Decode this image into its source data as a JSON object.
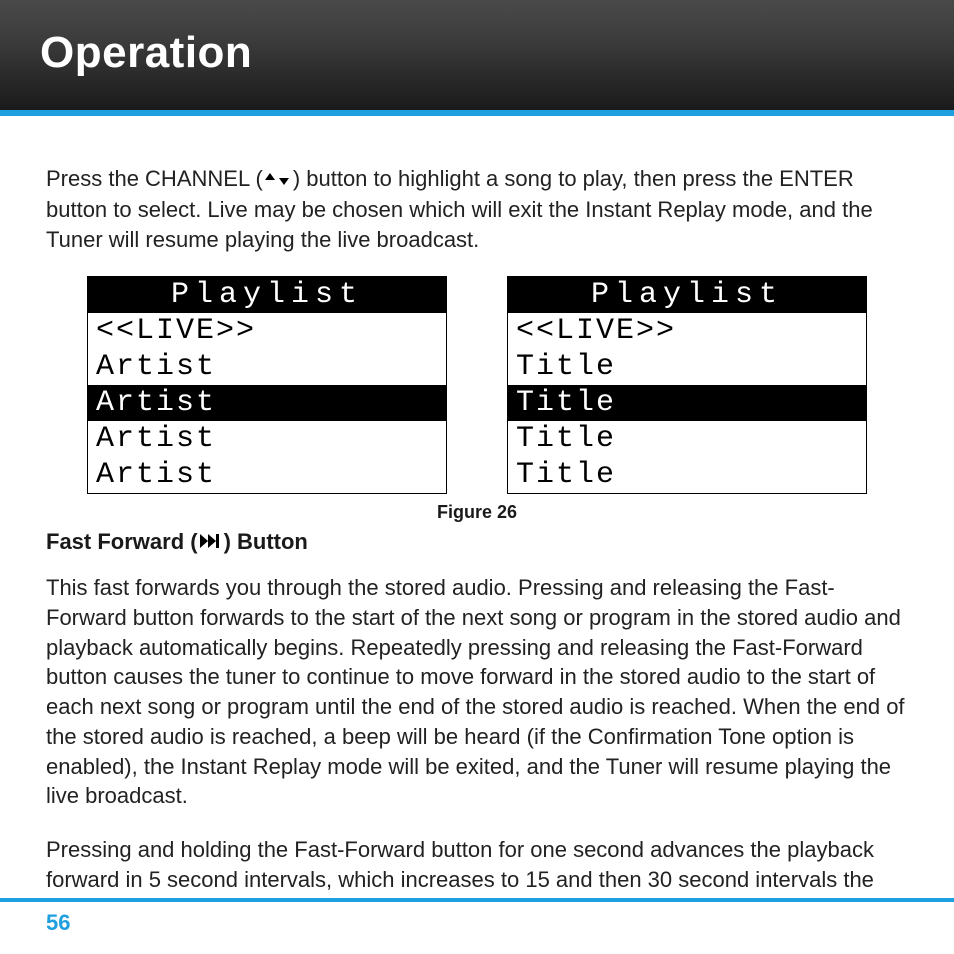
{
  "header": {
    "title": "Operation"
  },
  "intro": {
    "part1": "Press the CHANNEL (",
    "part2": ") button to highlight a song to play, then press the ENTER button to select. Live may be chosen which will exit the Instant Replay mode, and the Tuner will resume playing the live broadcast."
  },
  "figure": {
    "caption": "Figure 26",
    "left": {
      "header": "Playlist",
      "rows": [
        {
          "text": "<<LIVE>>",
          "highlight": false
        },
        {
          "text": "Artist",
          "highlight": false
        },
        {
          "text": "Artist",
          "highlight": true
        },
        {
          "text": "Artist",
          "highlight": false
        },
        {
          "text": "Artist",
          "highlight": false
        }
      ]
    },
    "right": {
      "header": "Playlist",
      "rows": [
        {
          "text": "<<LIVE>>",
          "highlight": false
        },
        {
          "text": "Title",
          "highlight": false
        },
        {
          "text": "Title",
          "highlight": true
        },
        {
          "text": "Title",
          "highlight": false
        },
        {
          "text": "Title",
          "highlight": false
        }
      ]
    }
  },
  "section": {
    "heading_pre": "Fast Forward (",
    "heading_post": ") Button",
    "para1": "This fast forwards you through the stored audio. Pressing and releasing the Fast-Forward button forwards to the start of the next song or program in the stored audio and playback automatically begins. Repeatedly pressing and releasing the Fast-Forward button causes the tuner to continue to move forward in the stored audio to the start of each next song or program until the end of the stored audio is reached. When the end of the stored audio is reached, a beep will be heard (if the Confirmation Tone option is enabled), the Instant Replay mode will be exited, and the Tuner will resume playing the live broadcast.",
    "para2": "Pressing and holding the Fast-Forward button for one second advances the playback forward in 5 second intervals, which increases to 15 and then 30 second intervals the longer the Fast-Forward button remains pressed. Playback begins"
  },
  "page_number": "56"
}
